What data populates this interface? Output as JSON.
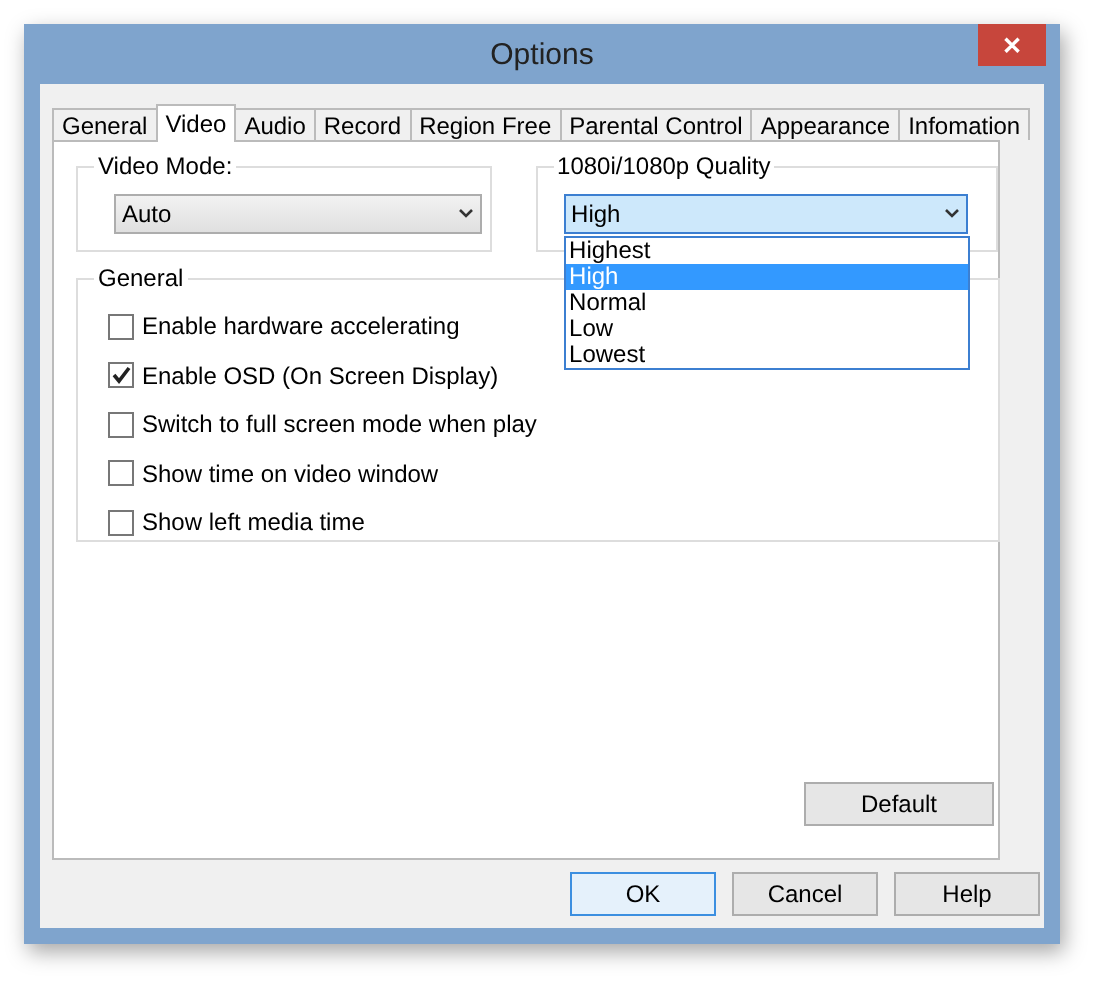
{
  "window": {
    "title": "Options",
    "close": "✕"
  },
  "tabs": [
    {
      "label": "General",
      "selected": false
    },
    {
      "label": "Video",
      "selected": true
    },
    {
      "label": "Audio",
      "selected": false
    },
    {
      "label": "Record",
      "selected": false
    },
    {
      "label": "Region Free",
      "selected": false
    },
    {
      "label": "Parental Control",
      "selected": false
    },
    {
      "label": "Appearance",
      "selected": false
    },
    {
      "label": "Infomation",
      "selected": false
    }
  ],
  "video_mode": {
    "label": "Video Mode:",
    "value": "Auto"
  },
  "quality": {
    "label": "1080i/1080p Quality",
    "value": "High",
    "expanded": true,
    "options": [
      {
        "label": "Highest",
        "selected": false
      },
      {
        "label": "High",
        "selected": true
      },
      {
        "label": "Normal",
        "selected": false
      },
      {
        "label": "Low",
        "selected": false
      },
      {
        "label": "Lowest",
        "selected": false
      }
    ]
  },
  "general": {
    "label": "General",
    "options": [
      {
        "label": "Enable hardware accelerating",
        "checked": false
      },
      {
        "label": "Enable OSD (On Screen Display)",
        "checked": true
      },
      {
        "label": "Switch to full screen mode when play",
        "checked": false
      },
      {
        "label": "Show time on video window",
        "checked": false
      },
      {
        "label": "Show left media time",
        "checked": false
      }
    ]
  },
  "default_button": "Default",
  "buttons": [
    {
      "label": "OK",
      "focused": true
    },
    {
      "label": "Cancel",
      "focused": false
    },
    {
      "label": "Help",
      "focused": false
    }
  ]
}
